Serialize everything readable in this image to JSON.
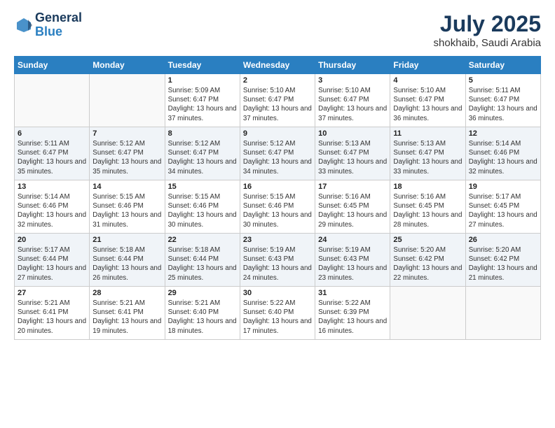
{
  "header": {
    "logo_line1": "General",
    "logo_line2": "Blue",
    "main_title": "July 2025",
    "subtitle": "shokhaib, Saudi Arabia"
  },
  "weekdays": [
    "Sunday",
    "Monday",
    "Tuesday",
    "Wednesday",
    "Thursday",
    "Friday",
    "Saturday"
  ],
  "weeks": [
    [
      {
        "day": "",
        "info": ""
      },
      {
        "day": "",
        "info": ""
      },
      {
        "day": "1",
        "info": "Sunrise: 5:09 AM\nSunset: 6:47 PM\nDaylight: 13 hours and 37 minutes."
      },
      {
        "day": "2",
        "info": "Sunrise: 5:10 AM\nSunset: 6:47 PM\nDaylight: 13 hours and 37 minutes."
      },
      {
        "day": "3",
        "info": "Sunrise: 5:10 AM\nSunset: 6:47 PM\nDaylight: 13 hours and 37 minutes."
      },
      {
        "day": "4",
        "info": "Sunrise: 5:10 AM\nSunset: 6:47 PM\nDaylight: 13 hours and 36 minutes."
      },
      {
        "day": "5",
        "info": "Sunrise: 5:11 AM\nSunset: 6:47 PM\nDaylight: 13 hours and 36 minutes."
      }
    ],
    [
      {
        "day": "6",
        "info": "Sunrise: 5:11 AM\nSunset: 6:47 PM\nDaylight: 13 hours and 35 minutes."
      },
      {
        "day": "7",
        "info": "Sunrise: 5:12 AM\nSunset: 6:47 PM\nDaylight: 13 hours and 35 minutes."
      },
      {
        "day": "8",
        "info": "Sunrise: 5:12 AM\nSunset: 6:47 PM\nDaylight: 13 hours and 34 minutes."
      },
      {
        "day": "9",
        "info": "Sunrise: 5:12 AM\nSunset: 6:47 PM\nDaylight: 13 hours and 34 minutes."
      },
      {
        "day": "10",
        "info": "Sunrise: 5:13 AM\nSunset: 6:47 PM\nDaylight: 13 hours and 33 minutes."
      },
      {
        "day": "11",
        "info": "Sunrise: 5:13 AM\nSunset: 6:47 PM\nDaylight: 13 hours and 33 minutes."
      },
      {
        "day": "12",
        "info": "Sunrise: 5:14 AM\nSunset: 6:46 PM\nDaylight: 13 hours and 32 minutes."
      }
    ],
    [
      {
        "day": "13",
        "info": "Sunrise: 5:14 AM\nSunset: 6:46 PM\nDaylight: 13 hours and 32 minutes."
      },
      {
        "day": "14",
        "info": "Sunrise: 5:15 AM\nSunset: 6:46 PM\nDaylight: 13 hours and 31 minutes."
      },
      {
        "day": "15",
        "info": "Sunrise: 5:15 AM\nSunset: 6:46 PM\nDaylight: 13 hours and 30 minutes."
      },
      {
        "day": "16",
        "info": "Sunrise: 5:15 AM\nSunset: 6:46 PM\nDaylight: 13 hours and 30 minutes."
      },
      {
        "day": "17",
        "info": "Sunrise: 5:16 AM\nSunset: 6:45 PM\nDaylight: 13 hours and 29 minutes."
      },
      {
        "day": "18",
        "info": "Sunrise: 5:16 AM\nSunset: 6:45 PM\nDaylight: 13 hours and 28 minutes."
      },
      {
        "day": "19",
        "info": "Sunrise: 5:17 AM\nSunset: 6:45 PM\nDaylight: 13 hours and 27 minutes."
      }
    ],
    [
      {
        "day": "20",
        "info": "Sunrise: 5:17 AM\nSunset: 6:44 PM\nDaylight: 13 hours and 27 minutes."
      },
      {
        "day": "21",
        "info": "Sunrise: 5:18 AM\nSunset: 6:44 PM\nDaylight: 13 hours and 26 minutes."
      },
      {
        "day": "22",
        "info": "Sunrise: 5:18 AM\nSunset: 6:44 PM\nDaylight: 13 hours and 25 minutes."
      },
      {
        "day": "23",
        "info": "Sunrise: 5:19 AM\nSunset: 6:43 PM\nDaylight: 13 hours and 24 minutes."
      },
      {
        "day": "24",
        "info": "Sunrise: 5:19 AM\nSunset: 6:43 PM\nDaylight: 13 hours and 23 minutes."
      },
      {
        "day": "25",
        "info": "Sunrise: 5:20 AM\nSunset: 6:42 PM\nDaylight: 13 hours and 22 minutes."
      },
      {
        "day": "26",
        "info": "Sunrise: 5:20 AM\nSunset: 6:42 PM\nDaylight: 13 hours and 21 minutes."
      }
    ],
    [
      {
        "day": "27",
        "info": "Sunrise: 5:21 AM\nSunset: 6:41 PM\nDaylight: 13 hours and 20 minutes."
      },
      {
        "day": "28",
        "info": "Sunrise: 5:21 AM\nSunset: 6:41 PM\nDaylight: 13 hours and 19 minutes."
      },
      {
        "day": "29",
        "info": "Sunrise: 5:21 AM\nSunset: 6:40 PM\nDaylight: 13 hours and 18 minutes."
      },
      {
        "day": "30",
        "info": "Sunrise: 5:22 AM\nSunset: 6:40 PM\nDaylight: 13 hours and 17 minutes."
      },
      {
        "day": "31",
        "info": "Sunrise: 5:22 AM\nSunset: 6:39 PM\nDaylight: 13 hours and 16 minutes."
      },
      {
        "day": "",
        "info": ""
      },
      {
        "day": "",
        "info": ""
      }
    ]
  ]
}
